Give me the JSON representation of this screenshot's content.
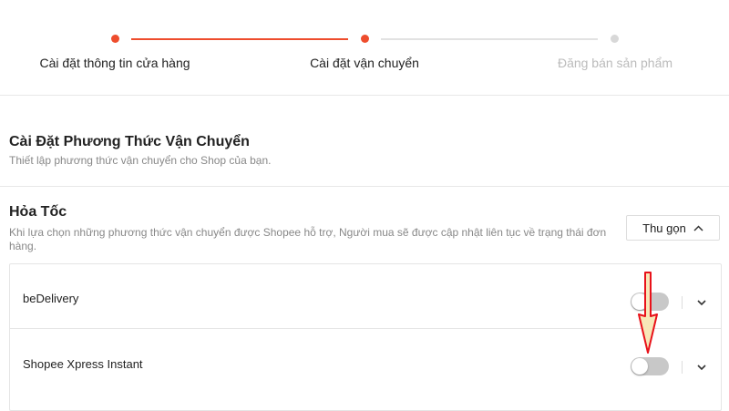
{
  "colors": {
    "accent": "#ee4d2d",
    "inactive": "#d8d8d8",
    "toggle_off": "#c8c8c8",
    "annotation_arrow": "#e8121a"
  },
  "stepper": {
    "steps": [
      {
        "label": "Cài đặt thông tin cửa hàng",
        "state": "done"
      },
      {
        "label": "Cài đặt vận chuyển",
        "state": "current"
      },
      {
        "label": "Đăng bán sản phẩm",
        "state": "upcoming"
      }
    ]
  },
  "shipping_settings": {
    "title": "Cài Đặt Phương Thức Vận Chuyển",
    "subtitle": "Thiết lập phương thức vận chuyển cho Shop của bạn."
  },
  "express": {
    "title": "Hỏa Tốc",
    "description": "Khi lựa chọn những phương thức vận chuyển được Shopee hỗ trợ, Người mua sẽ được cập nhật liên tục về trạng thái đơn hàng.",
    "collapse_label": "Thu gọn",
    "collapse_icon": "chevron-up-icon",
    "carriers": [
      {
        "name": "beDelivery",
        "enabled": false
      },
      {
        "name": "Shopee Xpress Instant",
        "enabled": false
      }
    ]
  }
}
